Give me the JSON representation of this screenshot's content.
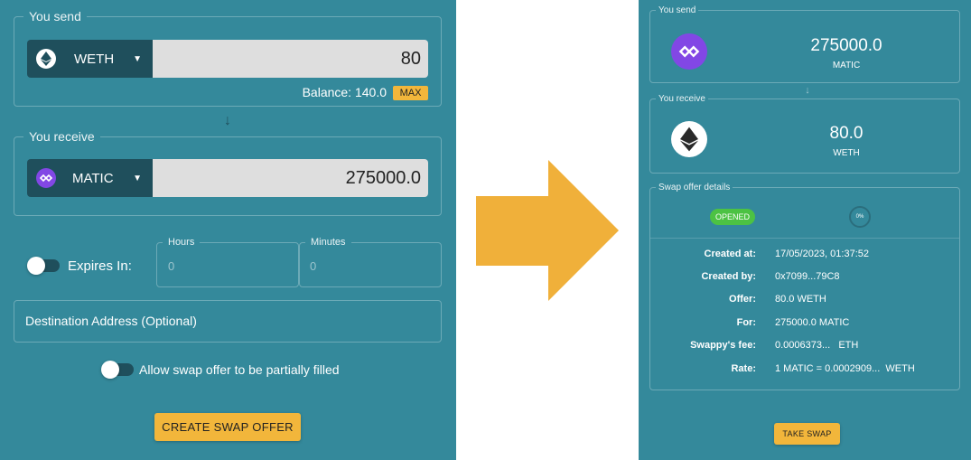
{
  "left": {
    "send": {
      "legend": "You send",
      "token": "WETH",
      "amount": "80",
      "balance": "Balance: 140.0",
      "max_label": "MAX"
    },
    "receive": {
      "legend": "You receive",
      "token": "MATIC",
      "amount": "275000.0"
    },
    "expires": {
      "label": "Expires In:",
      "hours_label": "Hours",
      "hours_placeholder": "0",
      "minutes_label": "Minutes",
      "minutes_placeholder": "0"
    },
    "destination_placeholder": "Destination Address (Optional)",
    "partial_label": "Allow swap offer to be partially filled",
    "create_button": "CREATE SWAP OFFER"
  },
  "right": {
    "send": {
      "legend": "You send",
      "amount": "275000.0",
      "token": "MATIC"
    },
    "receive": {
      "legend": "You receive",
      "amount": "80.0",
      "token": "WETH"
    },
    "details": {
      "legend": "Swap offer details",
      "status": "OPENED",
      "progress": "0%",
      "rows": [
        {
          "key": "Created at:",
          "value": "17/05/2023, 01:37:52"
        },
        {
          "key": "Created by:",
          "value": "0x7099...79C8"
        },
        {
          "key": "Offer:",
          "value": "80.0 WETH"
        },
        {
          "key": "For:",
          "value": "275000.0 MATIC"
        },
        {
          "key": "Swappy's fee:",
          "value": "0.0006373...   ETH"
        },
        {
          "key": "Rate:",
          "value": "1 MATIC = 0.0002909...  WETH"
        }
      ]
    },
    "take_button": "TAKE SWAP"
  },
  "colors": {
    "panel": "#34899b",
    "dark": "#1f4f5c",
    "accent": "#f2b63b",
    "opened": "#4cc243",
    "matic": "#8247e5",
    "arrow": "#f0b03a"
  }
}
